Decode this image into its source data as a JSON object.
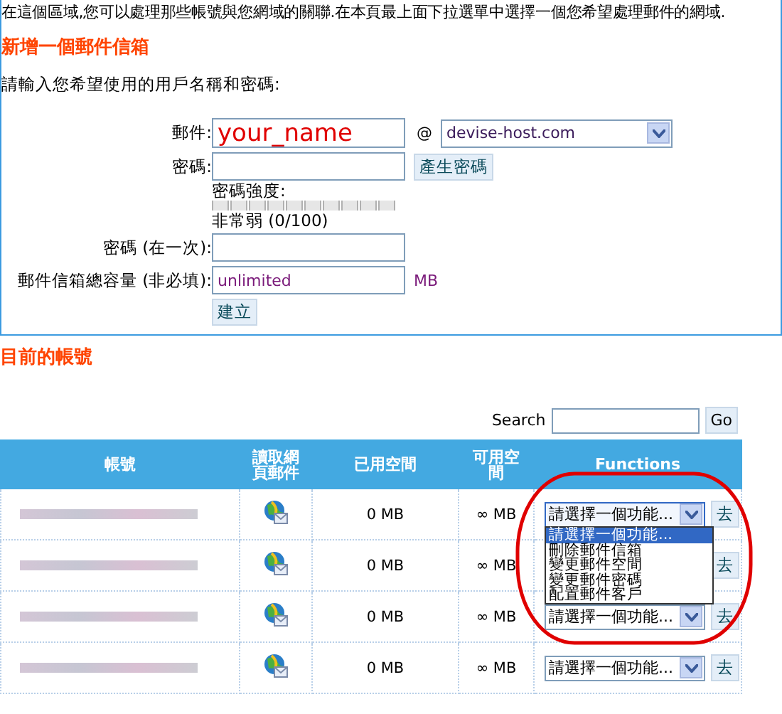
{
  "intro": "在這個區域,您可以處理那些帳號與您網域的關聯.在本頁最上面下拉選單中選擇一個您希望處理郵件的網域.",
  "add_mailbox": {
    "title": "新增一個郵件信箱",
    "prompt": "請輸入您希望使用的用戶名稱和密碼:",
    "email": {
      "label": "郵件:",
      "value": "your_name",
      "at": "@",
      "domain": "devise-host.com"
    },
    "password": {
      "label": "密碼:",
      "button": "產生密碼"
    },
    "strength": {
      "label": "密碼強度:",
      "level": 0,
      "reading": "非常弱 (0/100)"
    },
    "confirm": {
      "label": "密碼 (在一次):"
    },
    "quota": {
      "label": "郵件信箱總容量 (非必填):",
      "value": "unlimited",
      "unit": "MB"
    },
    "create_button": "建立"
  },
  "accounts": {
    "title": "目前的帳號",
    "search": {
      "label": "Search",
      "button": "Go"
    },
    "columns": [
      "帳號",
      "讀取網頁郵件",
      "已用空間",
      "可用空間",
      "Functions"
    ],
    "rows": [
      {
        "used": "0 MB",
        "available": "∞ MB",
        "function": "請選擇一個功能...",
        "go": "去",
        "expanded": true
      },
      {
        "used": "0 MB",
        "available": "∞ MB",
        "go": "去",
        "expanded": false
      },
      {
        "used": "0 MB",
        "available": "∞ MB",
        "function": "請選擇一個功能...",
        "go": "去",
        "expanded": false
      },
      {
        "used": "0 MB",
        "available": "∞ MB",
        "function": "請選擇一個功能...",
        "go": "去",
        "expanded": false
      }
    ],
    "function_options": [
      {
        "label": "請選擇一個功能...",
        "selected": true
      },
      {
        "label": "刪除郵件信箱",
        "selected": false
      },
      {
        "label": "變更郵件空間",
        "selected": false
      },
      {
        "label": "變更郵件密碼",
        "selected": false
      },
      {
        "label": "配置郵件客戶",
        "selected": false
      }
    ]
  }
}
